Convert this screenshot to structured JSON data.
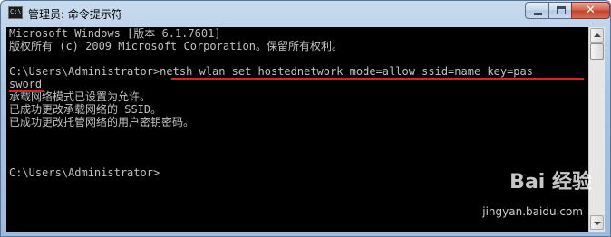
{
  "window": {
    "title": "管理员: 命令提示符",
    "icon_name": "cmd-icon",
    "icon_text": "C:\\"
  },
  "console": {
    "lines": [
      "Microsoft Windows [版本 6.1.7601]",
      "版权所有 (c) 2009 Microsoft Corporation。保留所有权利。",
      "",
      "C:\\Users\\Administrator>netsh wlan set hostednetwork mode=allow ssid=name key=pas",
      "sword",
      "承载网络模式已设置为允许。",
      "已成功更改承载网络的 SSID。",
      "已成功更改托管网络的用户密钥密码。",
      "",
      "",
      "C:\\Users\\Administrator>"
    ],
    "highlight_color": "#e02020"
  },
  "watermark": {
    "brand": "Bai 经验",
    "url": "jingyan.baidu.com"
  },
  "colors": {
    "console_bg": "#000000",
    "console_text": "#c0c0c0",
    "title_bar": "#a9c3e0"
  }
}
